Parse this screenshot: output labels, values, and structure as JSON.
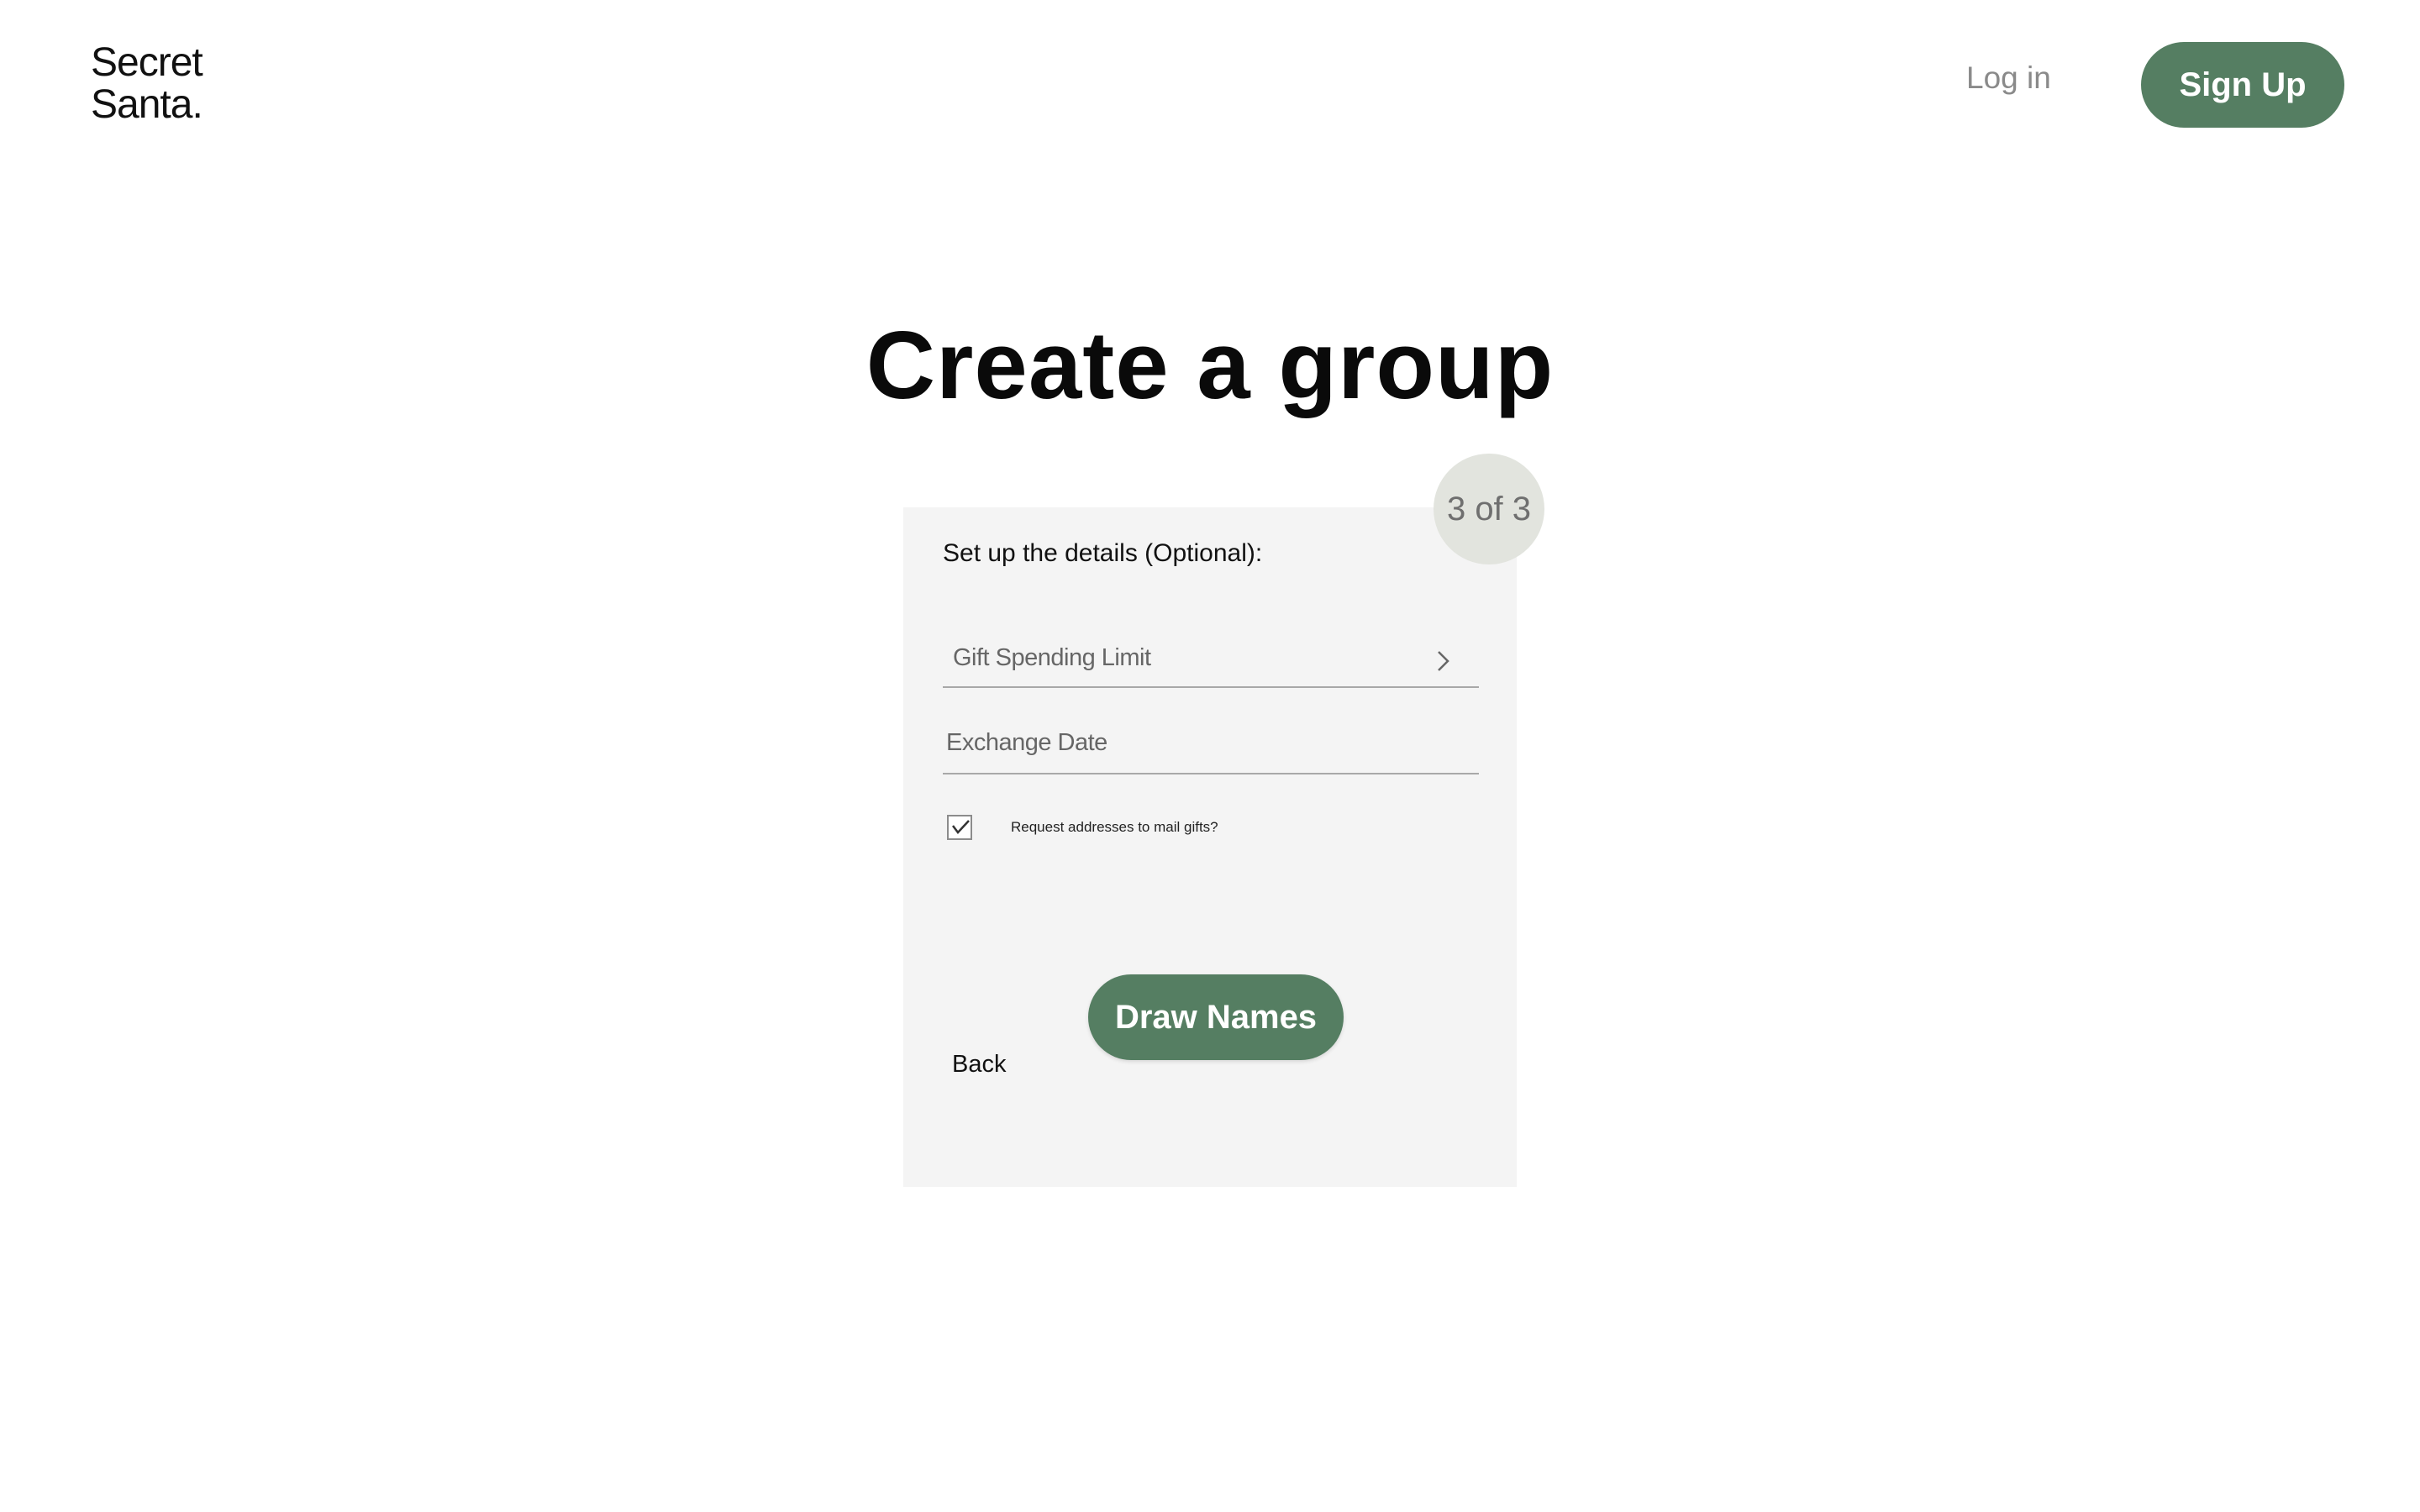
{
  "header": {
    "logo_line1": "Secret",
    "logo_line2": "Santa.",
    "login_label": "Log in",
    "signup_label": "Sign Up"
  },
  "main": {
    "title": "Create a group",
    "step_badge": "3 of 3",
    "card": {
      "heading": "Set up the details (Optional):",
      "gift_limit_label": "Gift Spending Limit",
      "exchange_date_label": "Exchange Date",
      "mail_checkbox_label": "Request addresses to mail gifts?",
      "mail_checkbox_checked": true,
      "draw_button_label": "Draw Names",
      "back_label": "Back"
    }
  },
  "colors": {
    "accent": "#557e62",
    "card_background": "#f4f4f4",
    "badge_background": "#e2e4de"
  },
  "icons": {
    "field_arrow": "chevron-right-icon",
    "checkbox_mark": "checkmark-icon"
  }
}
